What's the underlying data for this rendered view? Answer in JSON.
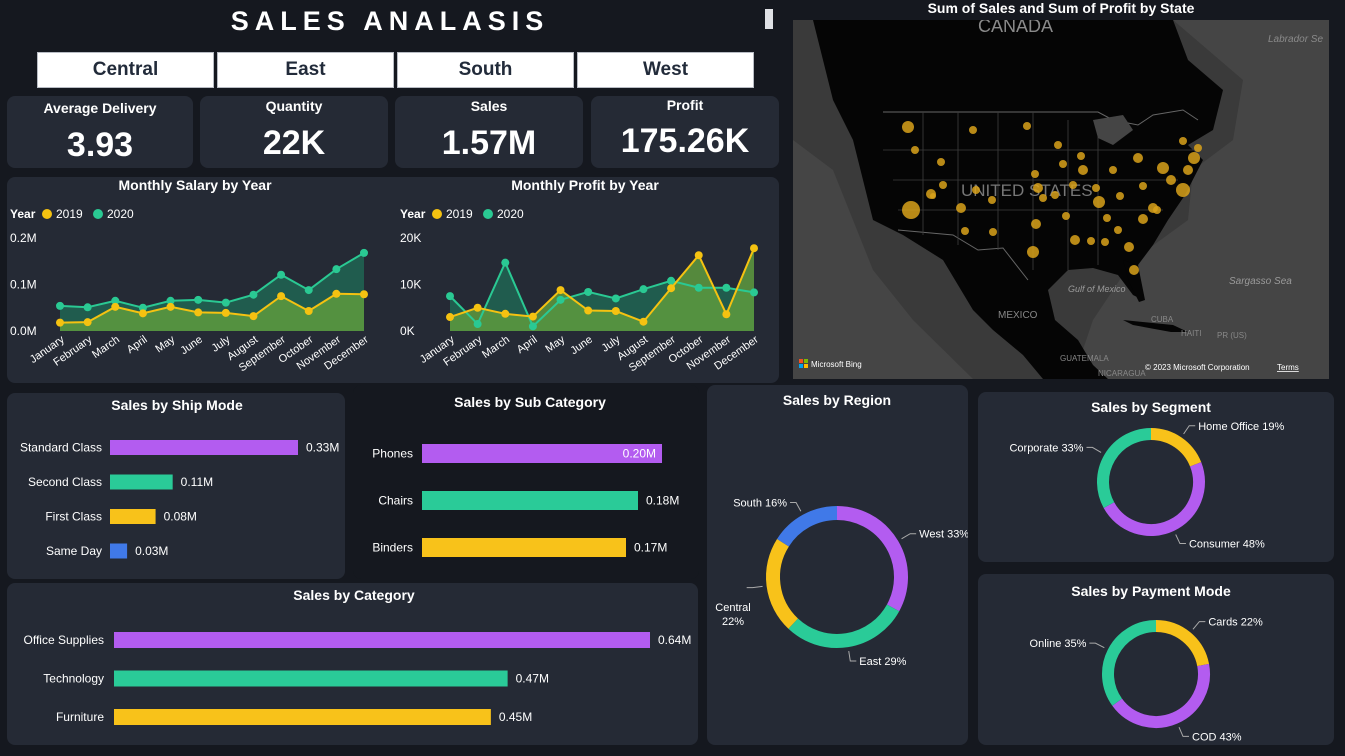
{
  "header": {
    "title": "SALES ANALASIS"
  },
  "region_buttons": [
    "Central",
    "East",
    "South",
    "West"
  ],
  "kpis": [
    {
      "label": "Average Delivery",
      "value": "3.93"
    },
    {
      "label": "Quantity",
      "value": "22K"
    },
    {
      "label": "Sales",
      "value": "1.57M"
    },
    {
      "label": "Profit",
      "value": "175.26K"
    }
  ],
  "colors": {
    "y2019": "#f5c211",
    "y2020": "#2ac993",
    "purple": "#b35cf0",
    "green": "#2acb98",
    "yellow": "#f8c21a",
    "blue": "#4079e8",
    "panel": "#252a35",
    "bg": "#15181f"
  },
  "chart_data": [
    {
      "type": "line",
      "title": "Monthly Salary by Year",
      "legend_title": "Year",
      "categories": [
        "January",
        "February",
        "March",
        "April",
        "May",
        "June",
        "July",
        "August",
        "September",
        "October",
        "November",
        "December"
      ],
      "series": [
        {
          "name": "2019",
          "values": [
            18000,
            19000,
            52000,
            38000,
            52000,
            40000,
            39000,
            32000,
            75000,
            43000,
            80000,
            79000
          ]
        },
        {
          "name": "2020",
          "values": [
            54000,
            51000,
            65000,
            50000,
            65000,
            67000,
            61000,
            78000,
            121000,
            88000,
            133000,
            168000
          ]
        }
      ],
      "ylim": [
        0,
        200000
      ],
      "yticks": [
        "0.0M",
        "0.1M",
        "0.2M"
      ]
    },
    {
      "type": "line",
      "title": "Monthly Profit by Year",
      "legend_title": "Year",
      "categories": [
        "January",
        "February",
        "March",
        "April",
        "May",
        "June",
        "July",
        "August",
        "September",
        "October",
        "November",
        "December"
      ],
      "series": [
        {
          "name": "2019",
          "values": [
            3000,
            5000,
            3700,
            3100,
            8800,
            4400,
            4300,
            2000,
            9200,
            16300,
            3600,
            17800
          ]
        },
        {
          "name": "2020",
          "values": [
            7500,
            1500,
            14700,
            1000,
            6700,
            8400,
            7000,
            9000,
            10800,
            9300,
            9300,
            8300
          ]
        }
      ],
      "ylim": [
        0,
        20000
      ],
      "yticks": [
        "0K",
        "10K",
        "20K"
      ]
    },
    {
      "type": "bar",
      "title": "Sales by Ship Mode",
      "categories": [
        "Standard Class",
        "Second Class",
        "First Class",
        "Same Day"
      ],
      "values": [
        0.33,
        0.11,
        0.08,
        0.03
      ],
      "labels": [
        "0.33M",
        "0.11M",
        "0.08M",
        "0.03M"
      ],
      "colors": [
        "#b35cf0",
        "#2acb98",
        "#f8c21a",
        "#4079e8"
      ]
    },
    {
      "type": "bar",
      "title": "Sales by Sub Category",
      "categories": [
        "Phones",
        "Chairs",
        "Binders"
      ],
      "values": [
        0.2,
        0.18,
        0.17
      ],
      "labels": [
        "0.20M",
        "0.18M",
        "0.17M"
      ],
      "colors": [
        "#b35cf0",
        "#2acb98",
        "#f8c21a"
      ]
    },
    {
      "type": "bar",
      "title": "Sales by Category",
      "categories": [
        "Office Supplies",
        "Technology",
        "Furniture"
      ],
      "values": [
        0.64,
        0.47,
        0.45
      ],
      "labels": [
        "0.64M",
        "0.47M",
        "0.45M"
      ],
      "colors": [
        "#b35cf0",
        "#2acb98",
        "#f8c21a"
      ]
    },
    {
      "type": "pie",
      "title": "Sales by Region",
      "slices": [
        {
          "name": "West",
          "value": 33,
          "label": "West 33%",
          "color": "#b35cf0"
        },
        {
          "name": "East",
          "value": 29,
          "label": "East 29%",
          "color": "#2acb98"
        },
        {
          "name": "Central",
          "value": 22,
          "label": "Central 22%",
          "color": "#f8c21a"
        },
        {
          "name": "South",
          "value": 16,
          "label": "South 16%",
          "color": "#4079e8"
        }
      ]
    },
    {
      "type": "pie",
      "title": "Sales by Segment",
      "slices": [
        {
          "name": "Home Office",
          "value": 19,
          "label": "Home Office 19%",
          "color": "#f8c21a"
        },
        {
          "name": "Consumer",
          "value": 48,
          "label": "Consumer 48%",
          "color": "#b35cf0"
        },
        {
          "name": "Corporate",
          "value": 33,
          "label": "Corporate 33%",
          "color": "#2acb98"
        }
      ]
    },
    {
      "type": "pie",
      "title": "Sales by Payment Mode",
      "slices": [
        {
          "name": "Cards",
          "value": 22,
          "label": "Cards 22%",
          "color": "#f8c21a"
        },
        {
          "name": "COD",
          "value": 43,
          "label": "COD 43%",
          "color": "#b35cf0"
        },
        {
          "name": "Online",
          "value": 35,
          "label": "Online 35%",
          "color": "#2acb98"
        }
      ]
    }
  ],
  "map": {
    "title": "Sum of Sales and Sum of Profit by State",
    "labels": {
      "canada": "CANADA",
      "usa": "UNITED STATES",
      "mexico": "MEXICO",
      "labrador": "Labrador Se",
      "sargasso": "Sargasso Sea",
      "gulf": "Gulf of Mexico",
      "cuba": "CUBA",
      "haiti": "HAITI",
      "pr": "PR (US)",
      "guatemala": "GUATEMALA",
      "nicaragua": "NICARAGUA"
    },
    "attribution": "Microsoft Bing",
    "copyright": "© 2023 Microsoft Corporation",
    "terms": "Terms"
  }
}
